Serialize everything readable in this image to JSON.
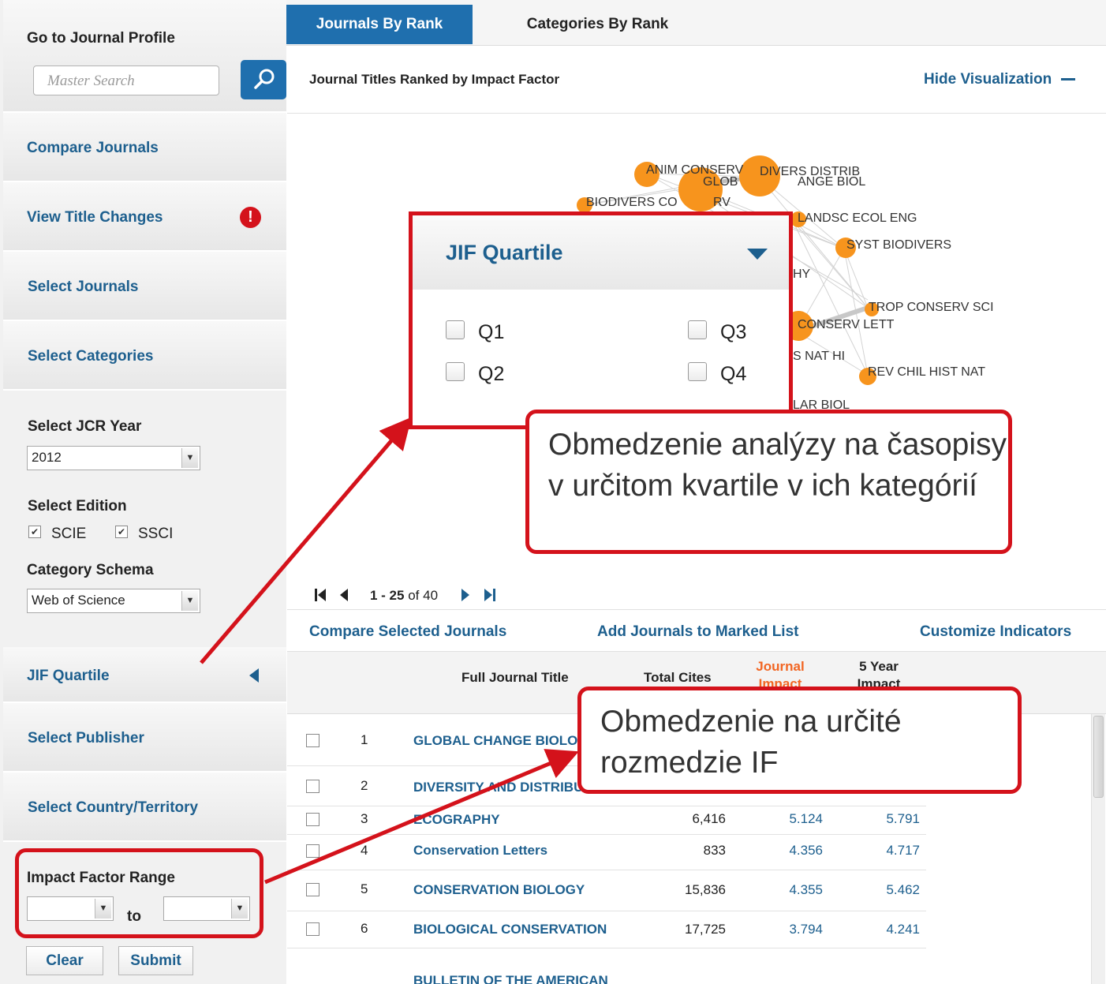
{
  "sidebar": {
    "go_to_profile": "Go to Journal Profile",
    "search_placeholder": "Master Search",
    "compare_journals": "Compare Journals",
    "view_title_changes": "View Title Changes",
    "select_journals": "Select Journals",
    "select_categories": "Select Categories",
    "jcr_year_label": "Select JCR Year",
    "jcr_year_value": "2012",
    "edition_label": "Select Edition",
    "edition_scie": "SCIE",
    "edition_ssci": "SSCI",
    "schema_label": "Category Schema",
    "schema_value": "Web of Science",
    "jif_quartile": "JIF Quartile",
    "select_publisher": "Select Publisher",
    "select_country": "Select Country/Territory",
    "if_range_label": "Impact Factor Range",
    "if_to": "to",
    "clear": "Clear",
    "submit": "Submit"
  },
  "tabs": [
    "Journals By Rank",
    "Categories By Rank"
  ],
  "viz": {
    "subtitle": "Journal Titles Ranked by Impact Factor",
    "hide": "Hide Visualization",
    "nodes": [
      "ANIM CONSERV",
      "GLOB",
      "DIVERS DISTRIB",
      "ANGE BIOL",
      "BIODIVERS CO",
      "RV",
      "LANDSC ECOL ENG",
      "SYST BIODIVERS",
      "HY",
      "TROP CONSERV SCI",
      "CONSERV LETT",
      "S NAT HI",
      "REV CHIL HIST NAT",
      "LAR BIOL"
    ]
  },
  "jif_panel": {
    "title": "JIF Quartile",
    "options": [
      "Q1",
      "Q2",
      "Q3",
      "Q4"
    ]
  },
  "callouts": {
    "quartile": "Obmedzenie analýzy na časopisy v určitom kvartile v ich kategórií",
    "range": "Obmedzenie na určité rozmedzie IF"
  },
  "pagination": {
    "range": "1 - 25",
    "of": " of 40"
  },
  "actions": {
    "compare": "Compare Selected Journals",
    "add_marked": "Add Journals to Marked List",
    "customize": "Customize Indicators"
  },
  "table": {
    "headers": {
      "title": "Full Journal Title",
      "cites": "Total Cites",
      "jif": "Journal Impact",
      "five_year": "5 Year Impact"
    },
    "rows": [
      {
        "rank": "1",
        "title": "GLOBAL CHANGE BIOLOG",
        "cites": "",
        "jif": "",
        "five": ""
      },
      {
        "rank": "2",
        "title": "DIVERSITY AND DISTRIBU",
        "cites": "",
        "jif": "",
        "five": ""
      },
      {
        "rank": "3",
        "title": "ECOGRAPHY",
        "cites": "6,416",
        "jif": "5.124",
        "five": "5.791"
      },
      {
        "rank": "4",
        "title": "Conservation Letters",
        "cites": "833",
        "jif": "4.356",
        "five": "4.717"
      },
      {
        "rank": "5",
        "title": "CONSERVATION BIOLOGY",
        "cites": "15,836",
        "jif": "4.355",
        "five": "5.462"
      },
      {
        "rank": "6",
        "title": "BIOLOGICAL CONSERVATION",
        "cites": "17,725",
        "jif": "3.794",
        "five": "4.241"
      },
      {
        "rank": "",
        "title": "BULLETIN OF THE AMERICAN",
        "cites": "",
        "jif": "",
        "five": ""
      }
    ]
  },
  "colors": {
    "accent": "#1d5f8e",
    "highlight": "#d4121b",
    "node": "#f7941d",
    "jif_header": "#f26522"
  }
}
